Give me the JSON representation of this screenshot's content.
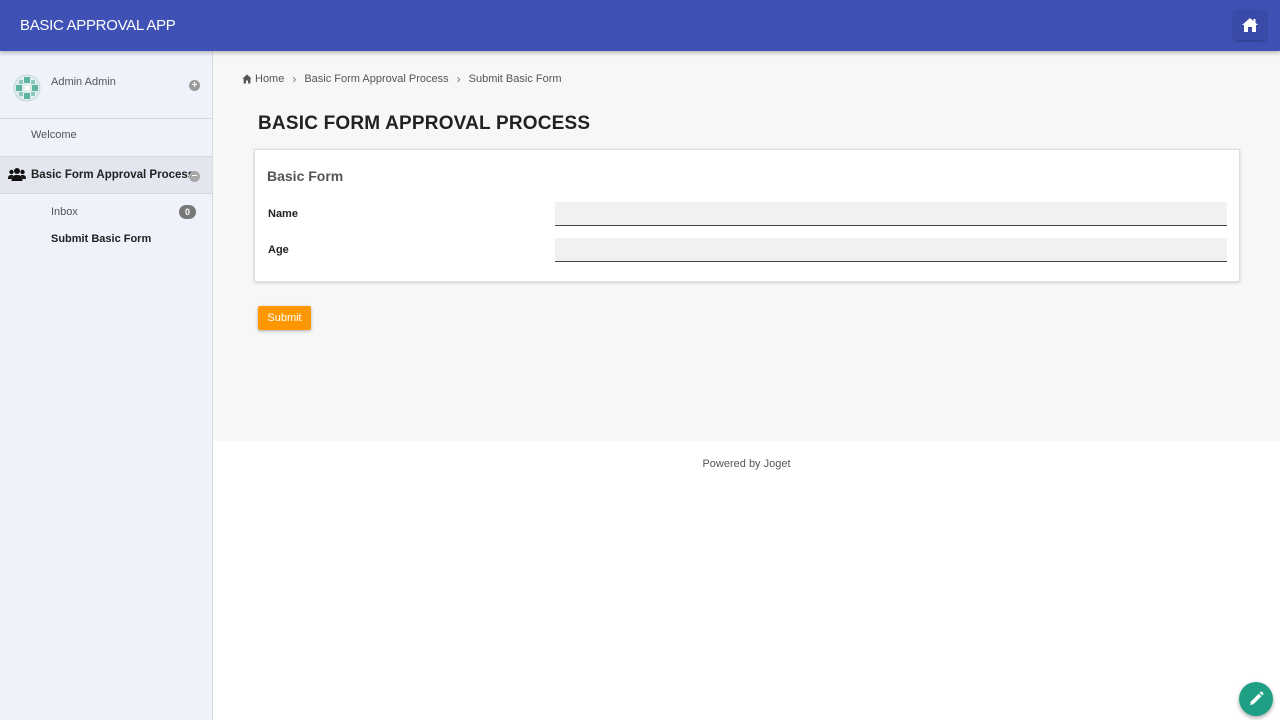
{
  "header": {
    "app_title": "BASIC APPROVAL APP",
    "home_icon": "home-icon",
    "color": "#3f51b5"
  },
  "sidebar": {
    "user_name": "Admin Admin",
    "welcome": "Welcome",
    "group": {
      "label": "Basic Form Approval Process",
      "icon": "users-icon"
    },
    "items": [
      {
        "label": "Inbox",
        "badge": "0"
      },
      {
        "label": "Submit Basic Form"
      }
    ]
  },
  "breadcrumb": {
    "home": "Home",
    "items": [
      "Basic Form Approval Process",
      "Submit Basic Form"
    ]
  },
  "main": {
    "page_title": "BASIC FORM APPROVAL PROCESS",
    "form": {
      "title": "Basic Form",
      "fields": [
        {
          "label": "Name",
          "value": ""
        },
        {
          "label": "Age",
          "value": ""
        }
      ]
    },
    "submit_label": "Submit",
    "submit_color": "#ff9800"
  },
  "footer": {
    "text": "Powered by Joget"
  },
  "fab": {
    "icon": "pencil-icon",
    "color": "#1fa085"
  }
}
